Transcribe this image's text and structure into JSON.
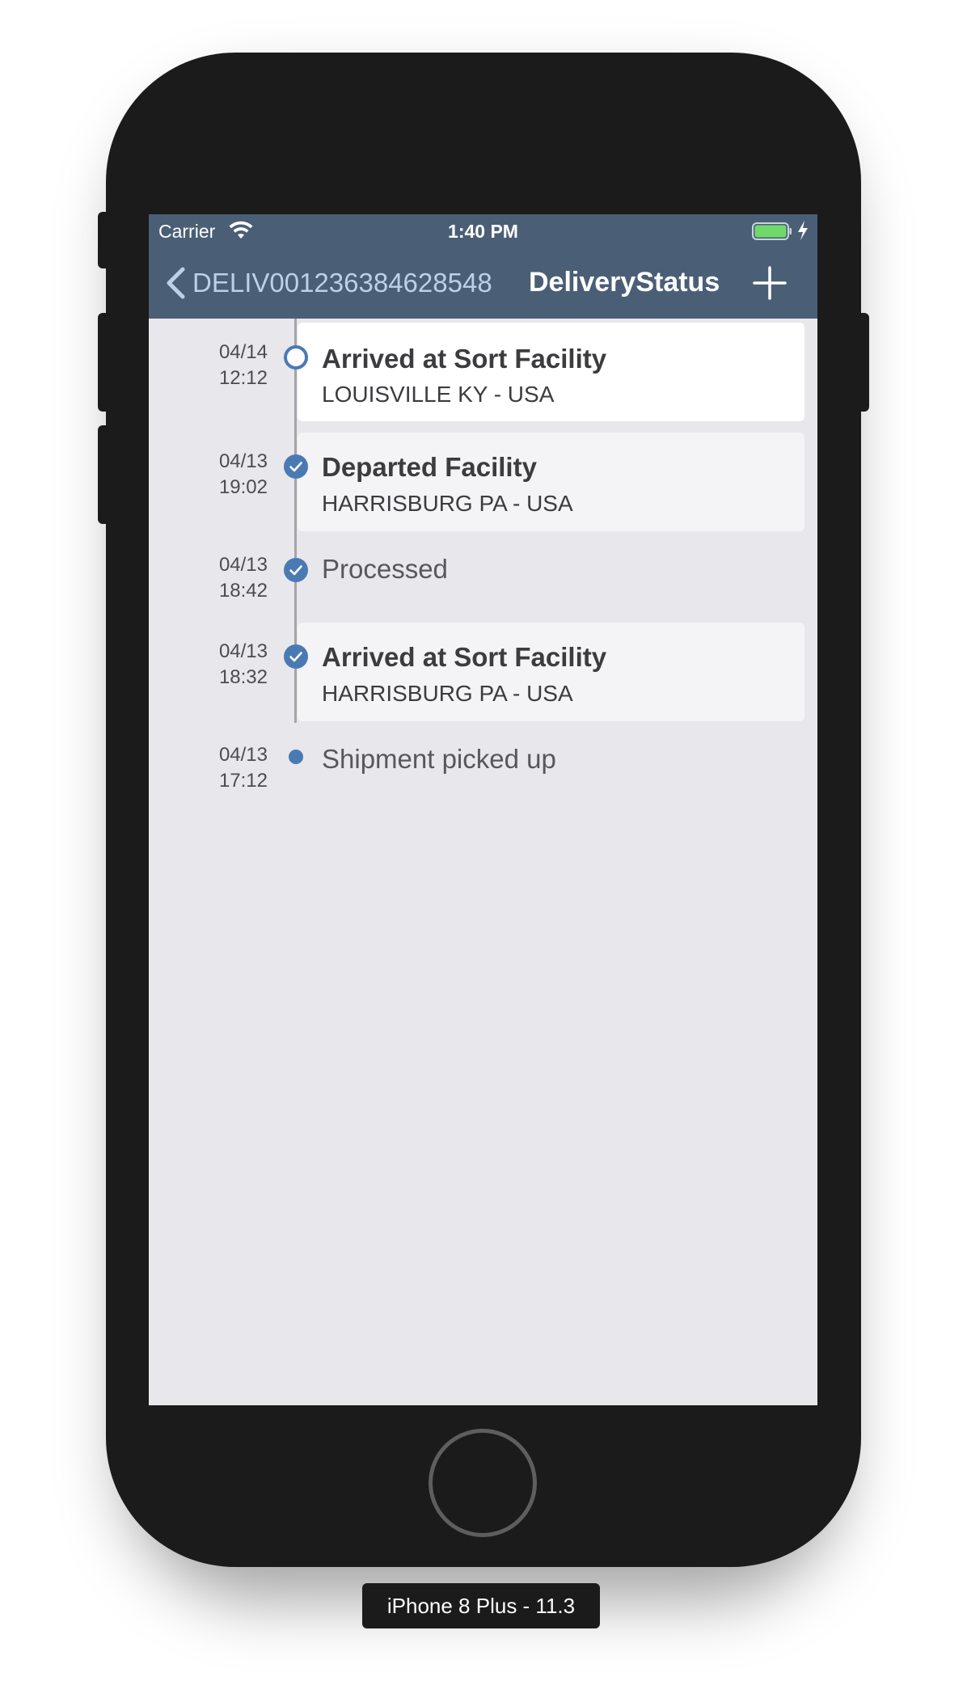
{
  "status_bar": {
    "carrier": "Carrier",
    "time": "1:40 PM"
  },
  "nav": {
    "back_label": "DELIV001236384628548",
    "title": "DeliveryStatus",
    "add_icon": "plus-icon"
  },
  "events": [
    {
      "date": "04/14",
      "time": "12:12",
      "title": "Arrived at Sort Facility",
      "location": "LOUISVILLE KY - USA",
      "marker": "empty-circle-icon"
    },
    {
      "date": "04/13",
      "time": "19:02",
      "title": "Departed Facility",
      "location": "HARRISBURG PA - USA",
      "marker": "check-circle-icon"
    },
    {
      "date": "04/13",
      "time": "18:42",
      "title": "Processed",
      "marker": "check-circle-icon"
    },
    {
      "date": "04/13",
      "time": "18:32",
      "title": "Arrived at Sort Facility",
      "location": "HARRISBURG PA - USA",
      "marker": "check-circle-icon"
    },
    {
      "date": "04/13",
      "time": "17:12",
      "title": "Shipment picked up",
      "marker": "dot-icon"
    }
  ],
  "device_label": "iPhone 8 Plus - 11.3",
  "colors": {
    "nav_background": "#4a5f76",
    "screen_background": "#e8e7ec",
    "marker_blue": "#4a7ab3",
    "battery_green": "#6ed96a",
    "device_body": "#1b1b1b"
  }
}
